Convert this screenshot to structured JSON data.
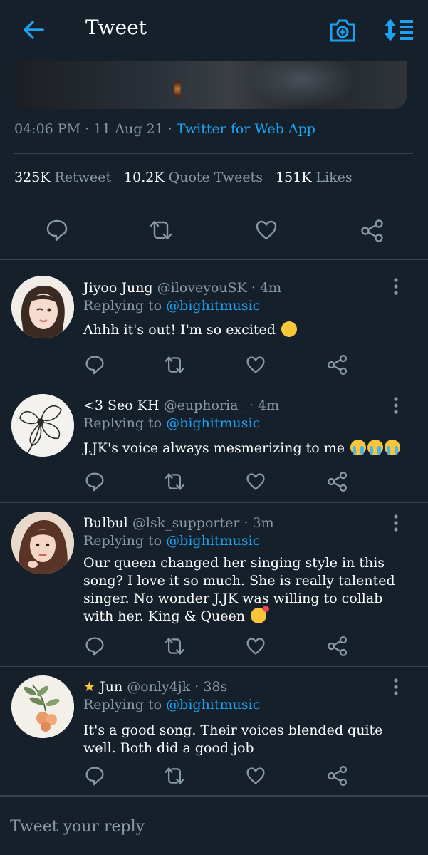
{
  "header": {
    "title": "Tweet",
    "back_icon": "arrow-left-icon",
    "camera_icon": "camera-icon",
    "sort_icon": "sort-icon",
    "accent": "#1da1f2"
  },
  "tweet": {
    "time": "04:06 PM",
    "date": "11 Aug 21",
    "source": "Twitter for Web App",
    "stats": {
      "retweets_count": "325K",
      "retweets_label": "Retweet",
      "quotes_count": "10.2K",
      "quotes_label": "Quote Tweets",
      "likes_count": "151K",
      "likes_label": "Likes"
    }
  },
  "replies": [
    {
      "name": "Jiyoo Jung",
      "handle": "@iloveyouSK",
      "time": "4m",
      "replying_prefix": "Replying to",
      "mention": "@bighitmusic",
      "text": "Ahhh it's out! I'm so excited",
      "emoji": "squinting-face"
    },
    {
      "name": "<3 Seo KH",
      "handle": "@euphoria_",
      "time": "4m",
      "replying_prefix": "Replying to",
      "mention": "@bighitmusic",
      "text": "J.JK's voice always mesmerizing to me",
      "emoji": "crying-face x3"
    },
    {
      "name": "Bulbul",
      "handle": "@lsk_supporter",
      "time": "3m",
      "replying_prefix": "Replying to",
      "mention": "@bighitmusic",
      "text": "Our queen changed her singing style in this song? I love it so much. She is really talented singer. No wonder J.JK was willing to collab with her. King & Queen",
      "emoji": "smiling-face-with-hearts"
    },
    {
      "name": "Jun",
      "name_prefix_icon": "star",
      "handle": "@only4jk",
      "time": "38s",
      "replying_prefix": "Replying to",
      "mention": "@bighitmusic",
      "text": "It's a good song. Their voices blended quite well. Both did a good job"
    }
  ],
  "composer": {
    "placeholder": "Tweet your reply"
  },
  "colors": {
    "background": "#15202b",
    "divider": "#38444d",
    "muted": "#8899a6",
    "accent": "#1da1f2"
  }
}
